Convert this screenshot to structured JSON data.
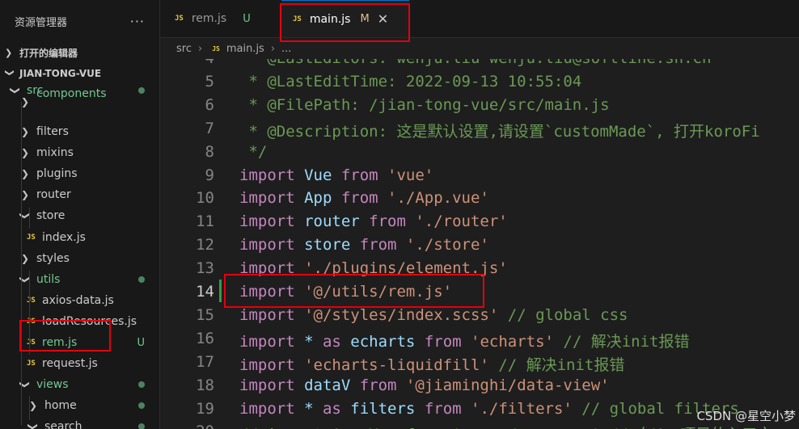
{
  "explorer": {
    "title": "资源管理器",
    "more": "···",
    "open_editors": "打开的编辑器",
    "project": "JIAN-TONG-VUE"
  },
  "tree": [
    {
      "label": "src",
      "kind": "folder",
      "open": true,
      "status": "dot",
      "green": true
    },
    {
      "label": "components",
      "kind": "folder",
      "open": false,
      "green": true
    },
    {
      "label": "filters",
      "kind": "folder",
      "open": false
    },
    {
      "label": "mixins",
      "kind": "folder",
      "open": false
    },
    {
      "label": "plugins",
      "kind": "folder",
      "open": false
    },
    {
      "label": "router",
      "kind": "folder",
      "open": false
    },
    {
      "label": "store",
      "kind": "folder",
      "open": true
    },
    {
      "label": "index.js",
      "kind": "file"
    },
    {
      "label": "styles",
      "kind": "folder",
      "open": false
    },
    {
      "label": "utils",
      "kind": "folder",
      "open": true,
      "status": "dot",
      "green": true
    },
    {
      "label": "axios-data.js",
      "kind": "file"
    },
    {
      "label": "loadResources.js",
      "kind": "file"
    },
    {
      "label": "rem.js",
      "kind": "file",
      "status": "U",
      "green": true
    },
    {
      "label": "request.js",
      "kind": "file"
    },
    {
      "label": "views",
      "kind": "folder",
      "open": true,
      "status": "dot",
      "green": true
    },
    {
      "label": "home",
      "kind": "folder",
      "open": false,
      "status": "dot"
    },
    {
      "label": "search",
      "kind": "folder",
      "open": true,
      "status": "dot"
    }
  ],
  "tabs": [
    {
      "label": "rem.js",
      "badge": "U",
      "active": false
    },
    {
      "label": "main.js",
      "badge": "M",
      "active": true,
      "close": "✕"
    }
  ],
  "breadcrumb": {
    "folder": "src",
    "file": "main.js",
    "tail": "..."
  },
  "editor": {
    "current_line": 14,
    "lines": [
      {
        "n": "4",
        "tokens": [
          {
            "t": " * @LastEditors: wenju.liu wenju.liu@softline.sh.cn",
            "c": "cm"
          }
        ]
      },
      {
        "n": "5",
        "tokens": [
          {
            "t": " * @LastEditTime: 2022-09-13 10:55:04",
            "c": "cm"
          }
        ]
      },
      {
        "n": "6",
        "tokens": [
          {
            "t": " * @FilePath: /jian-tong-vue/src/main.js",
            "c": "cm"
          }
        ]
      },
      {
        "n": "7",
        "tokens": [
          {
            "t": " * @Description: 这是默认设置,请设置`customMade`, 打开koroFi",
            "c": "cm"
          }
        ]
      },
      {
        "n": "8",
        "tokens": [
          {
            "t": " */",
            "c": "cm"
          }
        ]
      },
      {
        "n": "9",
        "tokens": [
          {
            "t": "import ",
            "c": "kw"
          },
          {
            "t": "Vue ",
            "c": "var"
          },
          {
            "t": "from ",
            "c": "kw"
          },
          {
            "t": "'vue'",
            "c": "str"
          }
        ]
      },
      {
        "n": "10",
        "tokens": [
          {
            "t": "import ",
            "c": "kw"
          },
          {
            "t": "App ",
            "c": "var"
          },
          {
            "t": "from ",
            "c": "kw"
          },
          {
            "t": "'./App.vue'",
            "c": "str"
          }
        ]
      },
      {
        "n": "11",
        "tokens": [
          {
            "t": "import ",
            "c": "kw"
          },
          {
            "t": "router ",
            "c": "var"
          },
          {
            "t": "from ",
            "c": "kw"
          },
          {
            "t": "'./router'",
            "c": "str"
          }
        ]
      },
      {
        "n": "12",
        "tokens": [
          {
            "t": "import ",
            "c": "kw"
          },
          {
            "t": "store ",
            "c": "var"
          },
          {
            "t": "from ",
            "c": "kw"
          },
          {
            "t": "'./store'",
            "c": "str"
          }
        ]
      },
      {
        "n": "13",
        "tokens": [
          {
            "t": "import ",
            "c": "kw"
          },
          {
            "t": "'./plugins/element.js'",
            "c": "str"
          }
        ]
      },
      {
        "n": "14",
        "tokens": [
          {
            "t": "import ",
            "c": "kw"
          },
          {
            "t": "'@/utils/rem.js'",
            "c": "str"
          }
        ]
      },
      {
        "n": "15",
        "tokens": [
          {
            "t": "import ",
            "c": "kw"
          },
          {
            "t": "'@/styles/index.scss' ",
            "c": "str"
          },
          {
            "t": "// global css",
            "c": "cm"
          }
        ]
      },
      {
        "n": "16",
        "tokens": [
          {
            "t": "import ",
            "c": "kw"
          },
          {
            "t": "* ",
            "c": "var"
          },
          {
            "t": "as ",
            "c": "kw"
          },
          {
            "t": "echarts ",
            "c": "var"
          },
          {
            "t": "from ",
            "c": "kw"
          },
          {
            "t": "'echarts' ",
            "c": "str"
          },
          {
            "t": "// 解决init报错",
            "c": "cm"
          }
        ]
      },
      {
        "n": "17",
        "tokens": [
          {
            "t": "import ",
            "c": "kw"
          },
          {
            "t": "'echarts-liquidfill' ",
            "c": "str"
          },
          {
            "t": "// 解决init报错",
            "c": "cm"
          }
        ]
      },
      {
        "n": "18",
        "tokens": [
          {
            "t": "import ",
            "c": "kw"
          },
          {
            "t": "dataV ",
            "c": "var"
          },
          {
            "t": "from ",
            "c": "kw"
          },
          {
            "t": "'@jiaminghi/data-view'",
            "c": "str"
          }
        ]
      },
      {
        "n": "19",
        "tokens": [
          {
            "t": "import ",
            "c": "kw"
          },
          {
            "t": "* ",
            "c": "var"
          },
          {
            "t": "as ",
            "c": "kw"
          },
          {
            "t": "filters ",
            "c": "var"
          },
          {
            "t": "from ",
            "c": "kw"
          },
          {
            "t": "'./filters' ",
            "c": "str"
          },
          {
            "t": "// global filters",
            "c": "cm"
          }
        ]
      },
      {
        "n": "20",
        "tokens": [
          {
            "t": "// import AvueVue from '@avue/avue.vue' // 在Vue项目的入口文",
            "c": "cm"
          }
        ]
      }
    ]
  },
  "watermark": "CSDN @星空小梦"
}
